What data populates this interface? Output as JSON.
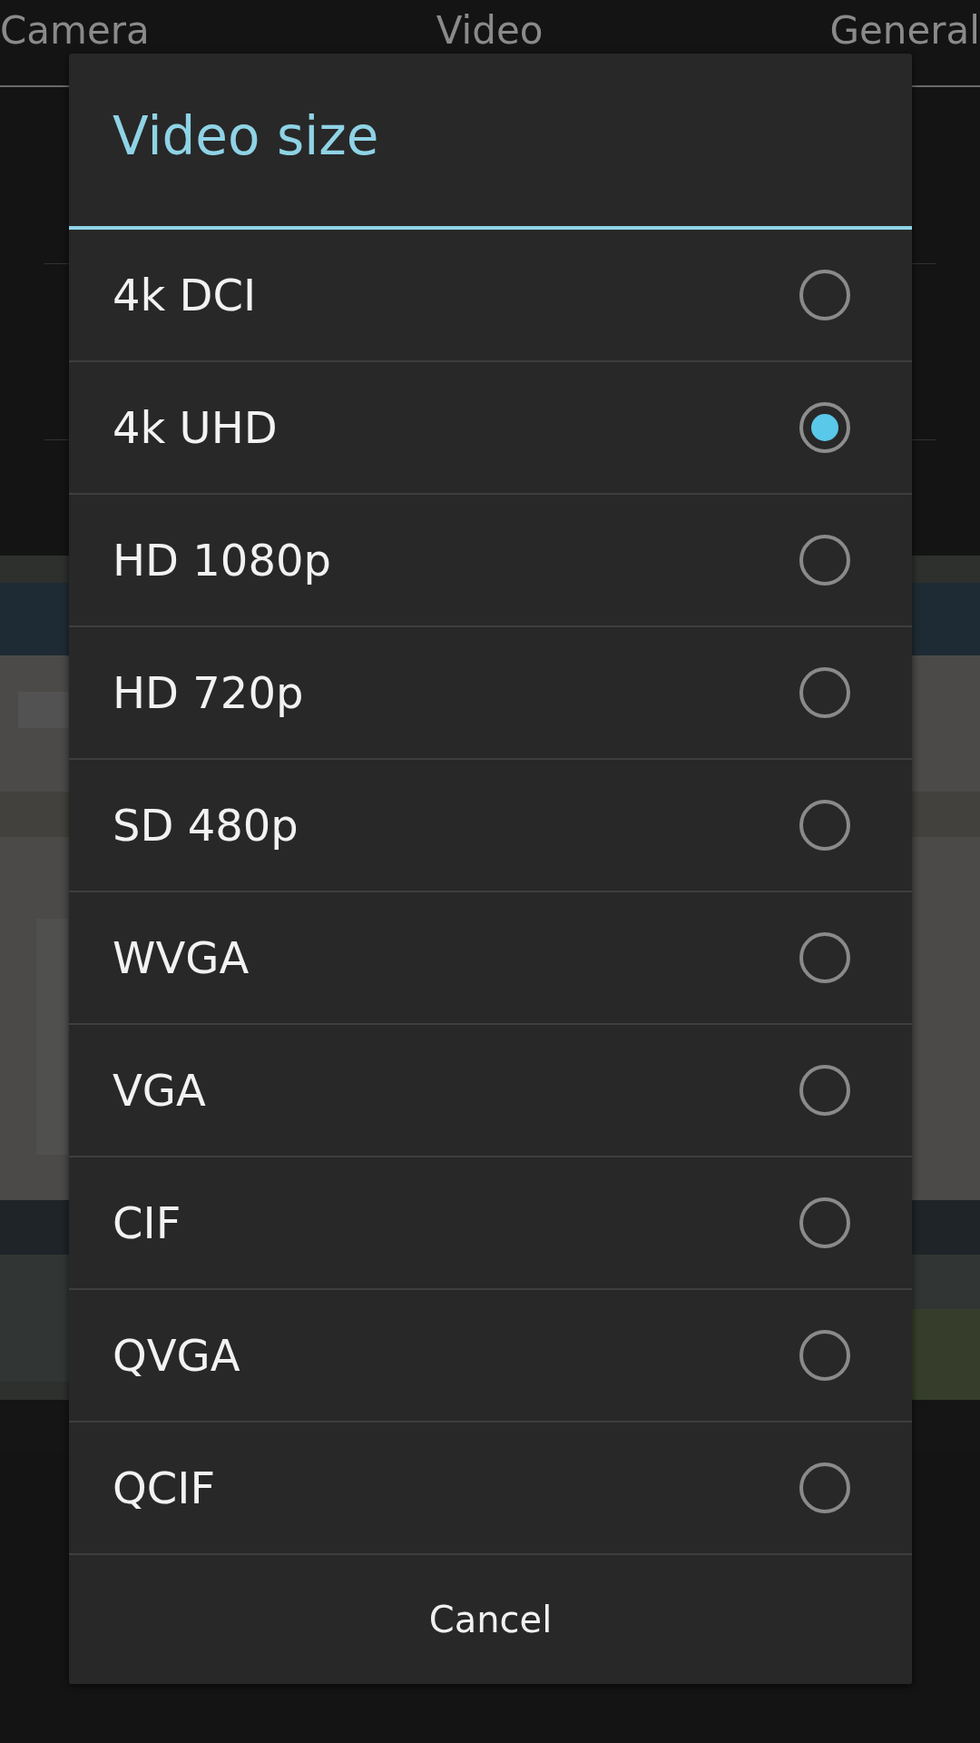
{
  "tabs": [
    {
      "label": "Camera"
    },
    {
      "label": "Video"
    },
    {
      "label": "General"
    }
  ],
  "dialog": {
    "title": "Video size",
    "options": [
      {
        "label": "4k DCI",
        "selected": false
      },
      {
        "label": "4k UHD",
        "selected": true
      },
      {
        "label": "HD 1080p",
        "selected": false
      },
      {
        "label": "HD 720p",
        "selected": false
      },
      {
        "label": "SD 480p",
        "selected": false
      },
      {
        "label": "WVGA",
        "selected": false
      },
      {
        "label": "VGA",
        "selected": false
      },
      {
        "label": "CIF",
        "selected": false
      },
      {
        "label": "QVGA",
        "selected": false
      },
      {
        "label": "QCIF",
        "selected": false
      }
    ],
    "cancel": "Cancel"
  }
}
